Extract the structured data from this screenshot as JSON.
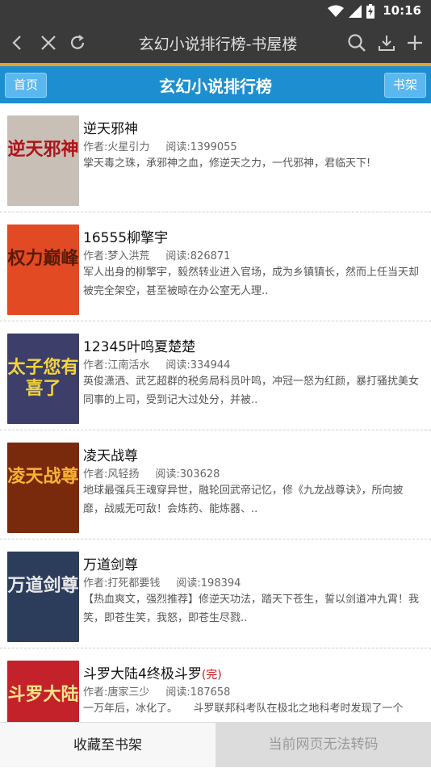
{
  "status": {
    "time": "10:16"
  },
  "browser": {
    "title": "玄幻小说排行榜-书屋楼"
  },
  "site": {
    "title": "玄幻小说排行榜",
    "home_label": "首页",
    "shelf_label": "书架"
  },
  "books": [
    {
      "name": "逆天邪神",
      "completed": "",
      "author": "作者:火星引力",
      "reads": "阅读:1399055",
      "desc": "掌天毒之珠，承邪神之血，修逆天之力，一代邪神，君临天下!",
      "cover_text": "逆天邪神",
      "cover_color": "#c8c0b6",
      "text_color": "#b1121a"
    },
    {
      "name": "16555柳擎宇",
      "completed": "",
      "author": "作者:梦入洪荒",
      "reads": "阅读:826871",
      "desc": "军人出身的柳擎宇，毅然转业进入官场，成为乡镇镇长，然而上任当天却被完全架空，甚至被晾在办公室无人理..",
      "cover_text": "权力巅峰",
      "cover_color": "#e14a23",
      "text_color": "#5b1a06"
    },
    {
      "name": "12345叶鸣夏楚楚",
      "completed": "",
      "author": "作者:江南活水",
      "reads": "阅读:334944",
      "desc": "英俊潇洒、武艺超群的税务局科员叶鸣，冲冠一怒为红颜，暴打骚扰美女同事的上司，受到记大过处分，并被..",
      "cover_text": "太子您有喜了",
      "cover_color": "#3d3f6a",
      "text_color": "#f3d53a"
    },
    {
      "name": "凌天战尊",
      "completed": "",
      "author": "作者:风轻扬",
      "reads": "阅读:303628",
      "desc": "地球最强兵王魂穿异世，融轮回武帝记忆，修《九龙战尊诀》，所向披靡，战威无可敌！会炼药、能炼器、..",
      "cover_text": "凌天战尊",
      "cover_color": "#7a2a0c",
      "text_color": "#f7b431"
    },
    {
      "name": "万道剑尊",
      "completed": "",
      "author": "作者:打死都要钱",
      "reads": "阅读:198394",
      "desc": "【热血爽文，强烈推荐】修逆天功法，踏天下苍生，誓以剑道冲九霄！我笑，即苍生笑，我怒，即苍生尽戮..",
      "cover_text": "万道剑尊",
      "cover_color": "#2c3d5c",
      "text_color": "#e8e8e8"
    },
    {
      "name": "斗罗大陆4终极斗罗",
      "completed": "(完)",
      "author": "作者:唐家三少",
      "reads": "阅读:187658",
      "desc": "一万年后，冰化了。　　斗罗联邦科考队在极北之地科考时发现了一个",
      "cover_text": "斗罗大陆",
      "cover_color": "#c4222a",
      "text_color": "#fbe38b"
    }
  ],
  "bottom": {
    "add_shelf": "收藏至书架",
    "no_transcode": "当前网页无法转码"
  }
}
